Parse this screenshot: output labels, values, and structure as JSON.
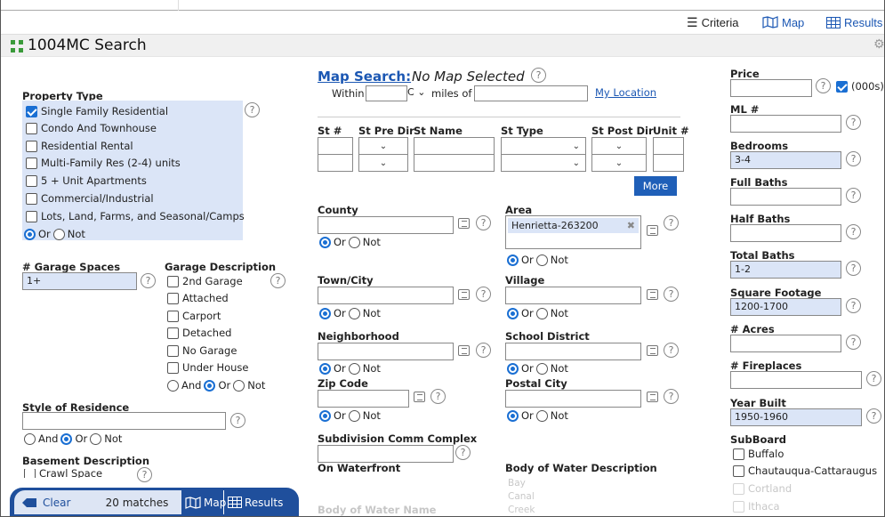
{
  "app": {
    "title": "1004MC Search"
  },
  "toptabs": {
    "criteria": "Criteria",
    "map": "Map",
    "results": "Results"
  },
  "map_search": {
    "title": "Map Search:",
    "status": "No Map Selected",
    "within": "Within",
    "miles_of": "miles of",
    "unit_value": "C",
    "my_location": "My Location"
  },
  "property_type": {
    "label": "Property Type",
    "options": [
      {
        "label": "Single Family Residential",
        "checked": true
      },
      {
        "label": "Condo And Townhouse",
        "checked": false
      },
      {
        "label": "Residential Rental",
        "checked": false
      },
      {
        "label": "Multi-Family Res (2-4) units",
        "checked": false
      },
      {
        "label": "5 + Unit Apartments",
        "checked": false
      },
      {
        "label": "Commercial/Industrial",
        "checked": false
      },
      {
        "label": "Lots, Land, Farms, and Seasonal/Camps",
        "checked": false
      }
    ]
  },
  "ornot": {
    "or": "Or",
    "not": "Not",
    "and": "And"
  },
  "garage_spaces": {
    "label": "# Garage Spaces",
    "value": "1+"
  },
  "garage_desc": {
    "label": "Garage Description",
    "options": [
      "2nd Garage",
      "Attached",
      "Carport",
      "Detached",
      "No Garage",
      "Under House"
    ]
  },
  "style": {
    "label": "Style of Residence"
  },
  "basement": {
    "label": "Basement Description",
    "first": "Crawl Space"
  },
  "address": {
    "st_num": "St #",
    "st_pre_dir": "St Pre Dir",
    "st_name": "St Name",
    "st_type": "St Type",
    "st_post_dir": "St Post Dir",
    "unit": "Unit #",
    "more": "More"
  },
  "county": {
    "label": "County"
  },
  "area": {
    "label": "Area",
    "value": "Henrietta-263200"
  },
  "town": {
    "label": "Town/City"
  },
  "village": {
    "label": "Village"
  },
  "neighborhood": {
    "label": "Neighborhood"
  },
  "school": {
    "label": "School District"
  },
  "zip": {
    "label": "Zip Code"
  },
  "postal_city": {
    "label": "Postal City"
  },
  "subdivision": {
    "label": "Subdivision Comm Complex"
  },
  "waterfront": {
    "label": "On Waterfront"
  },
  "water_desc": {
    "label": "Body of Water Description",
    "faded": [
      "Bay",
      "Canal",
      "Creek"
    ]
  },
  "water_name": {
    "label": "Body of Water Name"
  },
  "right": {
    "price": {
      "label": "Price",
      "unit": "(000s)"
    },
    "ml": {
      "label": "ML #"
    },
    "bedrooms": {
      "label": "Bedrooms",
      "value": "3-4"
    },
    "full_baths": {
      "label": "Full Baths"
    },
    "half_baths": {
      "label": "Half Baths"
    },
    "total_baths": {
      "label": "Total Baths",
      "value": "1-2"
    },
    "sqft": {
      "label": "Square Footage",
      "value": "1200-1700"
    },
    "acres": {
      "label": "# Acres"
    },
    "fireplaces": {
      "label": "# Fireplaces"
    },
    "year_built": {
      "label": "Year Built",
      "value": "1950-1960"
    },
    "subboard": {
      "label": "SubBoard",
      "options": [
        "Buffalo",
        "Chautauqua-Cattaraugus",
        "Cortland",
        "Ithaca"
      ]
    }
  },
  "bottom": {
    "clear": "Clear",
    "matches": "20 matches",
    "map": "Map",
    "results": "Results"
  },
  "help_glyph": "?",
  "colors": {
    "accent": "#1f5fb8",
    "filled": "#dbe5f7",
    "link": "#1b57b3"
  }
}
